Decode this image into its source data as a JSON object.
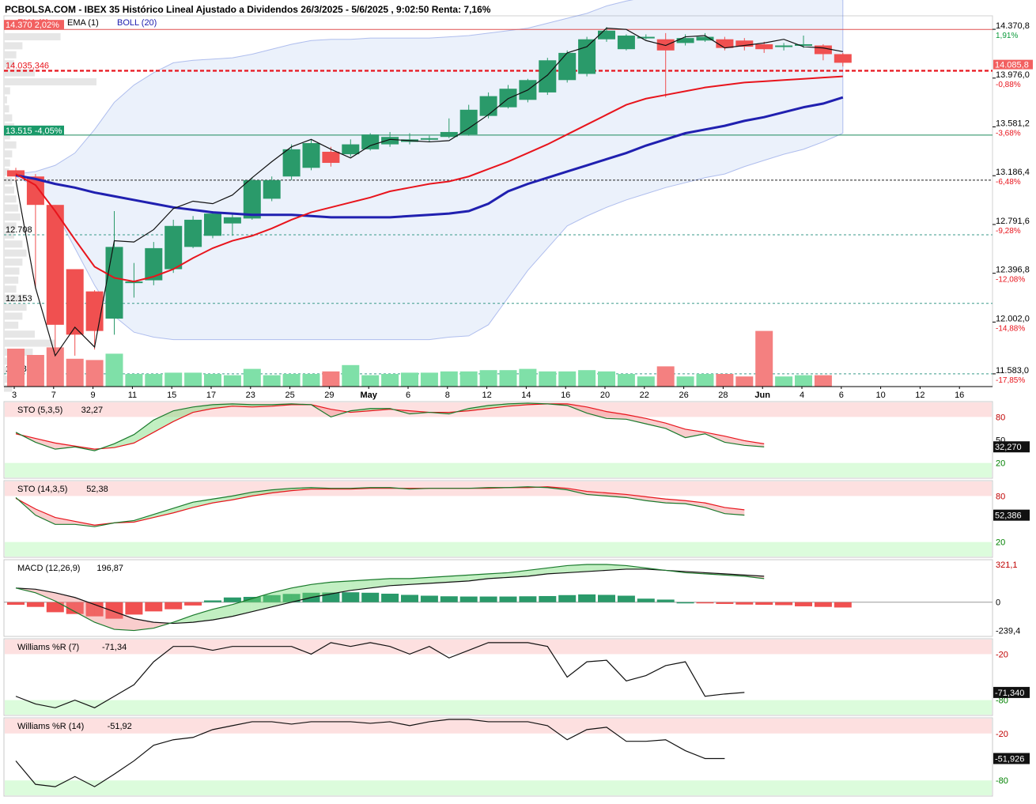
{
  "header": {
    "title": "PCBOLSA.COM - IBEX 35 Histórico Lineal Ajustado a Dividendos 26/3/2025 - 5/6/2025 , 9:02:50 Renta: 7,16%",
    "legend": [
      {
        "label": "EMA (9)",
        "color": "#e8141c"
      },
      {
        "label": "EMA (1)",
        "color": "#111111"
      },
      {
        "label": "BOLL (20)",
        "color": "#2020b0"
      }
    ]
  },
  "price_axis": {
    "ticks": [
      {
        "v": 14370.8,
        "label": "14.370,8",
        "pct": "1,91%"
      },
      {
        "v": 13976.0,
        "label": "13.976,0",
        "pct": "-0,88%"
      },
      {
        "v": 13581.2,
        "label": "13.581,2",
        "pct": "-3,68%"
      },
      {
        "v": 13186.4,
        "label": "13.186,4",
        "pct": "-6,48%"
      },
      {
        "v": 12791.6,
        "label": "12.791,6",
        "pct": "-9,28%"
      },
      {
        "v": 12396.8,
        "label": "12.396,8",
        "pct": "-12,08%"
      },
      {
        "v": 12002.0,
        "label": "12.002,0",
        "pct": "-14,88%"
      },
      {
        "v": 11583.0,
        "label": "11.583,0",
        "pct": "-17,85%"
      }
    ],
    "last_price": {
      "v": 14085.8,
      "label": "14.085,8"
    }
  },
  "level_tags": [
    {
      "v": 14370,
      "label": "14.370  2,02%",
      "kind": "red"
    },
    {
      "v": 14035.346,
      "label": "14.035,346",
      "kind": "red-dash"
    },
    {
      "v": 13515,
      "label": "13.515  -4,05%",
      "kind": "green"
    },
    {
      "v": 13150,
      "label": "",
      "kind": "black"
    },
    {
      "v": 12708,
      "label": "12.708",
      "kind": "plain"
    },
    {
      "v": 12153,
      "label": "12.153",
      "kind": "plain"
    },
    {
      "v": 11583,
      "label": "11.583",
      "kind": "plain"
    }
  ],
  "date_axis": [
    {
      "i": 0,
      "label": "3"
    },
    {
      "i": 2,
      "label": "7"
    },
    {
      "i": 4,
      "label": "9"
    },
    {
      "i": 6,
      "label": "11"
    },
    {
      "i": 8,
      "label": "15"
    },
    {
      "i": 10,
      "label": "17"
    },
    {
      "i": 12,
      "label": "23"
    },
    {
      "i": 14,
      "label": "25"
    },
    {
      "i": 16,
      "label": "29"
    },
    {
      "i": 18,
      "label": "May",
      "bold": true
    },
    {
      "i": 20,
      "label": "6"
    },
    {
      "i": 22,
      "label": "8"
    },
    {
      "i": 24,
      "label": "12"
    },
    {
      "i": 26,
      "label": "14"
    },
    {
      "i": 28,
      "label": "16"
    },
    {
      "i": 30,
      "label": "20"
    },
    {
      "i": 32,
      "label": "22"
    },
    {
      "i": 34,
      "label": "26"
    },
    {
      "i": 36,
      "label": "28"
    },
    {
      "i": 38,
      "label": "Jun",
      "bold": true
    },
    {
      "i": 40,
      "label": "4"
    },
    {
      "i": 42,
      "label": "6"
    },
    {
      "i": 44,
      "label": "10"
    },
    {
      "i": 46,
      "label": "12"
    },
    {
      "i": 48,
      "label": "16"
    }
  ],
  "chart_data": {
    "type": "candlestick",
    "ylim": [
      11480,
      14480
    ],
    "candles": [
      {
        "o": 13230,
        "h": 13250,
        "l": 13140,
        "c": 13180
      },
      {
        "o": 13180,
        "h": 13200,
        "l": 12280,
        "c": 12950
      },
      {
        "o": 12950,
        "h": 12950,
        "l": 11760,
        "c": 11980
      },
      {
        "o": 12430,
        "h": 12430,
        "l": 11730,
        "c": 11900
      },
      {
        "o": 12250,
        "h": 12260,
        "l": 11780,
        "c": 11930
      },
      {
        "o": 12030,
        "h": 12900,
        "l": 11900,
        "c": 12610
      },
      {
        "o": 12320,
        "h": 12480,
        "l": 12200,
        "c": 12330
      },
      {
        "o": 12340,
        "h": 12650,
        "l": 12300,
        "c": 12600
      },
      {
        "o": 12430,
        "h": 12830,
        "l": 12400,
        "c": 12780
      },
      {
        "o": 12610,
        "h": 12860,
        "l": 12600,
        "c": 12830
      },
      {
        "o": 12700,
        "h": 12900,
        "l": 12680,
        "c": 12880
      },
      {
        "o": 12800,
        "h": 12880,
        "l": 12700,
        "c": 12850
      },
      {
        "o": 12840,
        "h": 13170,
        "l": 12830,
        "c": 13150
      },
      {
        "o": 13000,
        "h": 13180,
        "l": 12980,
        "c": 13150
      },
      {
        "o": 13180,
        "h": 13440,
        "l": 13150,
        "c": 13400
      },
      {
        "o": 13250,
        "h": 13480,
        "l": 13230,
        "c": 13450
      },
      {
        "o": 13380,
        "h": 13420,
        "l": 13260,
        "c": 13290
      },
      {
        "o": 13360,
        "h": 13480,
        "l": 13340,
        "c": 13440
      },
      {
        "o": 13400,
        "h": 13530,
        "l": 13390,
        "c": 13520
      },
      {
        "o": 13440,
        "h": 13540,
        "l": 13420,
        "c": 13500
      },
      {
        "o": 13460,
        "h": 13530,
        "l": 13440,
        "c": 13480
      },
      {
        "o": 13480,
        "h": 13510,
        "l": 13460,
        "c": 13490
      },
      {
        "o": 13500,
        "h": 13650,
        "l": 13490,
        "c": 13540
      },
      {
        "o": 13520,
        "h": 13760,
        "l": 13510,
        "c": 13720
      },
      {
        "o": 13670,
        "h": 13860,
        "l": 13650,
        "c": 13830
      },
      {
        "o": 13740,
        "h": 13920,
        "l": 13730,
        "c": 13890
      },
      {
        "o": 13800,
        "h": 13970,
        "l": 13780,
        "c": 13960
      },
      {
        "o": 13860,
        "h": 14140,
        "l": 13840,
        "c": 14120
      },
      {
        "o": 13960,
        "h": 14200,
        "l": 13940,
        "c": 14180
      },
      {
        "o": 14010,
        "h": 14310,
        "l": 13990,
        "c": 14290
      },
      {
        "o": 14290,
        "h": 14390,
        "l": 14270,
        "c": 14360
      },
      {
        "o": 14210,
        "h": 14330,
        "l": 14200,
        "c": 14320
      },
      {
        "o": 14300,
        "h": 14330,
        "l": 14290,
        "c": 14310
      },
      {
        "o": 14290,
        "h": 14340,
        "l": 13820,
        "c": 14200
      },
      {
        "o": 14260,
        "h": 14330,
        "l": 14240,
        "c": 14300
      },
      {
        "o": 14280,
        "h": 14340,
        "l": 14270,
        "c": 14310
      },
      {
        "o": 14290,
        "h": 14310,
        "l": 14200,
        "c": 14220
      },
      {
        "o": 14280,
        "h": 14300,
        "l": 14200,
        "c": 14230
      },
      {
        "o": 14250,
        "h": 14270,
        "l": 14180,
        "c": 14210
      },
      {
        "o": 14230,
        "h": 14260,
        "l": 14200,
        "c": 14240
      },
      {
        "o": 14240,
        "h": 14320,
        "l": 14220,
        "c": 14250
      },
      {
        "o": 14240,
        "h": 14250,
        "l": 14120,
        "c": 14170
      },
      {
        "o": 14170,
        "h": 14180,
        "l": 14070,
        "c": 14100
      }
    ],
    "ema1": [
      13150,
      12280,
      11730,
      11960,
      11800,
      12660,
      12650,
      12750,
      12920,
      12980,
      12960,
      13030,
      13170,
      13300,
      13420,
      13480,
      13400,
      13330,
      13430,
      13480,
      13470,
      13460,
      13470,
      13570,
      13680,
      13810,
      13880,
      14000,
      14180,
      14230,
      14380,
      14370,
      14280,
      14240,
      14310,
      14320,
      14220,
      14240,
      14260,
      14290,
      14230,
      14220,
      14190
    ],
    "ema9": [
      13200,
      13110,
      12900,
      12670,
      12450,
      12360,
      12330,
      12370,
      12430,
      12520,
      12600,
      12660,
      12700,
      12760,
      12830,
      12890,
      12930,
      12970,
      13010,
      13060,
      13090,
      13120,
      13140,
      13180,
      13240,
      13300,
      13370,
      13440,
      13520,
      13600,
      13680,
      13760,
      13810,
      13840,
      13870,
      13900,
      13920,
      13940,
      13950,
      13960,
      13970,
      13980,
      13990
    ],
    "bollMid": [
      13190,
      13160,
      13120,
      13090,
      13050,
      13020,
      12990,
      12960,
      12930,
      12910,
      12890,
      12880,
      12870,
      12870,
      12870,
      12860,
      12850,
      12850,
      12850,
      12850,
      12860,
      12870,
      12880,
      12900,
      12960,
      13060,
      13120,
      13170,
      13220,
      13270,
      13320,
      13370,
      13430,
      13480,
      13530,
      13560,
      13590,
      13630,
      13660,
      13700,
      13740,
      13770,
      13820
    ],
    "bollUp": [
      13200,
      13220,
      13270,
      13370,
      13560,
      13780,
      13920,
      14020,
      14100,
      14120,
      14130,
      14140,
      14170,
      14210,
      14250,
      14280,
      14290,
      14290,
      14300,
      14300,
      14300,
      14300,
      14310,
      14320,
      14340,
      14360,
      14380,
      14420,
      14460,
      14500,
      14560,
      14600,
      14630,
      14640,
      14650,
      14660,
      14660,
      14660,
      14650,
      14640,
      14630,
      14620,
      14610
    ],
    "bollDn": [
      13180,
      13100,
      12900,
      12600,
      12300,
      12050,
      11920,
      11880,
      11860,
      11860,
      11860,
      11860,
      11860,
      11860,
      11860,
      11860,
      11860,
      11860,
      11860,
      11860,
      11860,
      11860,
      11880,
      11890,
      11980,
      12200,
      12420,
      12600,
      12780,
      12860,
      12930,
      12990,
      13040,
      13090,
      13130,
      13170,
      13200,
      13260,
      13310,
      13360,
      13400,
      13460,
      13530
    ],
    "volume": [
      0.3,
      0.25,
      0.31,
      0.22,
      0.21,
      0.26,
      0.1,
      0.1,
      0.11,
      0.11,
      0.1,
      0.09,
      0.14,
      0.09,
      0.1,
      0.1,
      0.12,
      0.17,
      0.09,
      0.1,
      0.11,
      0.11,
      0.12,
      0.12,
      0.13,
      0.13,
      0.14,
      0.12,
      0.12,
      0.13,
      0.12,
      0.1,
      0.08,
      0.16,
      0.08,
      0.1,
      0.1,
      0.08,
      0.44,
      0.08,
      0.09,
      0.09
    ],
    "volume_profile": [
      0.55,
      0.18,
      0.12,
      0.1,
      0.3,
      0.9,
      0.06,
      0.03,
      0.05,
      0.08,
      0.1,
      0.06,
      0.12,
      0.08,
      0.06,
      0.05,
      0.08,
      0.1,
      0.12,
      0.14,
      0.16,
      0.12,
      0.1,
      0.18,
      0.22,
      0.18,
      0.15,
      0.14,
      0.12,
      0.2,
      0.22,
      0.18,
      0.14,
      0.3,
      0.5,
      0.28,
      0.18,
      0.12,
      0.1,
      0.08
    ]
  },
  "panels": [
    {
      "id": "sto-fast",
      "title": "STO (5,3,5)",
      "value": "32,27",
      "value_box": "32,270",
      "ylim": [
        0,
        100
      ],
      "ticks": [
        {
          "v": 80,
          "label": "80",
          "color": "#c00000"
        },
        {
          "v": 50,
          "label": "50",
          "color": "#000000"
        },
        {
          "v": 20,
          "label": "20",
          "color": "#008000"
        }
      ],
      "zones": [
        80,
        20
      ],
      "lineA": [
        60,
        47,
        38,
        41,
        36,
        45,
        57,
        76,
        88,
        93,
        96,
        97,
        96,
        96,
        97,
        96,
        80,
        88,
        91,
        91,
        84,
        86,
        84,
        91,
        95,
        97,
        98,
        97,
        95,
        85,
        78,
        77,
        71,
        65,
        53,
        58,
        47,
        43,
        41
      ],
      "lineB": [
        58,
        52,
        46,
        42,
        38,
        40,
        46,
        60,
        74,
        86,
        91,
        94,
        93,
        94,
        96,
        96,
        90,
        86,
        88,
        90,
        88,
        86,
        86,
        88,
        91,
        94,
        96,
        97,
        97,
        93,
        87,
        83,
        78,
        72,
        64,
        60,
        55,
        49,
        45
      ],
      "colorA": "#1a7a2c",
      "colorB": "#e8141c"
    },
    {
      "id": "sto-slow",
      "title": "STO (14,3,5)",
      "value": "52,38",
      "value_box": "52,386",
      "ylim": [
        0,
        100
      ],
      "ticks": [
        {
          "v": 80,
          "label": "80",
          "color": "#c00000"
        },
        {
          "v": 20,
          "label": "20",
          "color": "#008000"
        }
      ],
      "zones": [
        80,
        20
      ],
      "lineA": [
        78,
        55,
        43,
        43,
        40,
        45,
        48,
        56,
        64,
        72,
        76,
        80,
        85,
        88,
        90,
        91,
        90,
        90,
        91,
        91,
        89,
        90,
        90,
        90,
        91,
        91,
        92,
        91,
        88,
        82,
        80,
        78,
        74,
        71,
        70,
        65,
        57,
        55
      ],
      "lineB": [
        77,
        63,
        52,
        47,
        42,
        45,
        46,
        52,
        58,
        65,
        71,
        75,
        80,
        84,
        87,
        89,
        89,
        89,
        90,
        90,
        90,
        90,
        90,
        90,
        90,
        91,
        91,
        92,
        90,
        86,
        84,
        82,
        79,
        76,
        74,
        71,
        65,
        62
      ],
      "colorA": "#1a7a2c",
      "colorB": "#e8141c"
    },
    {
      "id": "macd",
      "title": "MACD (12,26,9)",
      "value": "196,87",
      "ylim": [
        -290,
        360
      ],
      "ticks": [
        {
          "v": 321.1,
          "label": "321,1",
          "color": "#c00000"
        },
        {
          "v": 0,
          "label": "0",
          "color": "#000000"
        },
        {
          "v": -239.4,
          "label": "-239,4",
          "color": "#000000"
        }
      ],
      "zones": [],
      "lineA": [
        120,
        80,
        10,
        -80,
        -170,
        -230,
        -240,
        -220,
        -170,
        -110,
        -60,
        -20,
        30,
        80,
        120,
        150,
        170,
        180,
        190,
        200,
        200,
        210,
        220,
        230,
        240,
        250,
        270,
        290,
        310,
        320,
        320,
        310,
        290,
        270,
        250,
        240,
        230,
        220,
        200
      ],
      "lineB": [
        120,
        110,
        80,
        40,
        -20,
        -80,
        -140,
        -170,
        -180,
        -170,
        -150,
        -120,
        -80,
        -40,
        0,
        40,
        70,
        100,
        120,
        140,
        150,
        160,
        170,
        180,
        200,
        210,
        220,
        240,
        250,
        260,
        270,
        280,
        280,
        270,
        260,
        250,
        240,
        230,
        220
      ],
      "colorA": "#1a7a2c",
      "colorB": "#111111",
      "histogram": [
        -22,
        -40,
        -85,
        -100,
        -120,
        -140,
        -105,
        -78,
        -60,
        -28,
        15,
        40,
        45,
        60,
        70,
        80,
        82,
        84,
        80,
        72,
        62,
        55,
        50,
        48,
        48,
        48,
        50,
        52,
        60,
        66,
        62,
        55,
        30,
        22,
        0,
        -10,
        -15,
        -20,
        -22,
        -25,
        -35,
        -40,
        -45
      ]
    },
    {
      "id": "willr7",
      "title": "Williams %R (7)",
      "value": "-71,34",
      "value_box": "-71,340",
      "ylim": [
        -100,
        0
      ],
      "ticks": [
        {
          "v": -20,
          "label": "-20",
          "color": "#c00000"
        },
        {
          "v": -80,
          "label": "-80",
          "color": "#008000"
        }
      ],
      "zones": [
        -20,
        -80
      ],
      "lineA": [
        -75,
        -85,
        -90,
        -80,
        -90,
        -75,
        -60,
        -30,
        -10,
        -10,
        -15,
        -10,
        -10,
        -10,
        -10,
        -20,
        -5,
        -10,
        -5,
        -10,
        -20,
        -10,
        -25,
        -15,
        -5,
        -5,
        -5,
        -10,
        -50,
        -30,
        -28,
        -55,
        -48,
        -35,
        -30,
        -75,
        -72,
        -70
      ],
      "colorA": "#111111"
    },
    {
      "id": "willr14",
      "title": "Williams %R (14)",
      "value": "-51,92",
      "value_box": "-51,926",
      "ylim": [
        -100,
        0
      ],
      "ticks": [
        {
          "v": -20,
          "label": "-20",
          "color": "#c00000"
        },
        {
          "v": -80,
          "label": "-80",
          "color": "#008000"
        }
      ],
      "zones": [
        -20,
        -80
      ],
      "lineA": [
        -55,
        -85,
        -88,
        -75,
        -88,
        -72,
        -55,
        -35,
        -28,
        -25,
        -15,
        -10,
        -5,
        -5,
        -8,
        -5,
        -5,
        -5,
        -7,
        -5,
        -10,
        -5,
        -2,
        -2,
        -5,
        -5,
        -5,
        -10,
        -28,
        -15,
        -12,
        -30,
        -30,
        -28,
        -42,
        -52,
        -52
      ],
      "colorA": "#111111"
    }
  ]
}
